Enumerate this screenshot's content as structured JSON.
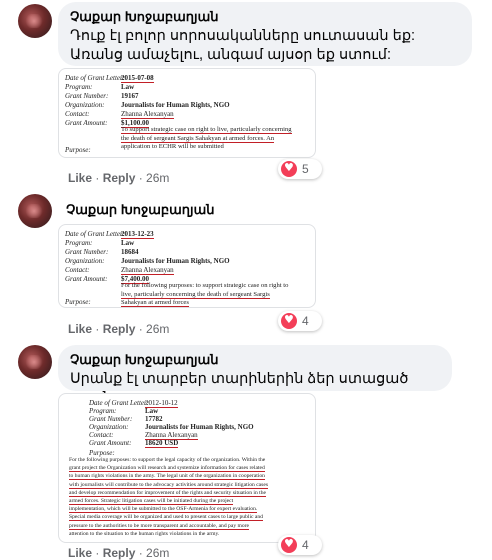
{
  "comments": [
    {
      "author": "Չաքար Խոջաբաղյան",
      "text": "Դուք էլ բոլոր սորոսականները սուտասան եք: Առանց ամաչելու, անգամ այսօր եք ստում:",
      "doc": {
        "rows": [
          {
            "label": "Date of Grant Letter:",
            "value": "2015-07-08"
          },
          {
            "label": "Program:",
            "value": "Law"
          },
          {
            "label": "Grant Number:",
            "value": "19167"
          },
          {
            "label": "Organization:",
            "value": "Journalists for Human Rights, NGO"
          },
          {
            "label": "Contact:",
            "value": "Zhanna Alexanyan"
          },
          {
            "label": "Grant Amount:",
            "value": "$1,100.00"
          },
          {
            "label": "Purpose:",
            "value": ""
          }
        ],
        "purpose_lines": [
          "To support strategic case on right to live, particularly concerning",
          "the death of sergeant Sargis Sahakyan at armed forces. An",
          "application to ECHR will be submitted"
        ]
      },
      "actions": {
        "like": "Like",
        "reply": "Reply",
        "time": "26m"
      },
      "reaction_count": "5"
    },
    {
      "author": "Չաքար Խոջաբաղյան",
      "doc": {
        "rows": [
          {
            "label": "Date of Grant Letter:",
            "value": "2013-12-23"
          },
          {
            "label": "Program:",
            "value": "Law"
          },
          {
            "label": "Grant Number:",
            "value": "18684"
          },
          {
            "label": "Organization:",
            "value": "Journalists for Human Rights, NGO"
          },
          {
            "label": "Contact:",
            "value": "Zhanna Alexanyan"
          },
          {
            "label": "Grant Amount:",
            "value": "$7,400.00"
          },
          {
            "label": "Purpose:",
            "value": ""
          }
        ],
        "purpose_lines": [
          "For the following purposes: to support strategic case on right to",
          "live, particularly concerning the death of sergeant Sargis",
          "Sahakyan at armed forces"
        ]
      },
      "actions": {
        "like": "Like",
        "reply": "Reply",
        "time": "26m"
      },
      "reaction_count": "4"
    },
    {
      "author": "Չաքար Խոջաբաղյան",
      "text": "Սրանք էլ տարբեր տարիներին ձեր ստացած գրանտը",
      "doc": {
        "rows": [
          {
            "label": "Date of Grant Letter:",
            "value": "2012-10-12"
          },
          {
            "label": "Program:",
            "value": "Law"
          },
          {
            "label": "Grant Number:",
            "value": "17782"
          },
          {
            "label": "Organization:",
            "value": "Journalists for Human Rights, NGO"
          },
          {
            "label": "Contact:",
            "value": "Zhanna Alexanyan"
          },
          {
            "label": "Grant Amount:",
            "value": "18620 USD"
          },
          {
            "label": "Purpose:",
            "value": ""
          }
        ],
        "purpose_lines": [
          "For the following purposes: to support the legal capacity of the organization. Within the",
          "grant project the Organization will research and systemize information for cases related",
          "to human rights violations in the army. The legal unit of the organization in cooperation",
          "with journalists will contribute to the advocacy activities around strategic litigation cases",
          "and develop recommendation for improvement of the rights and security situation in the",
          "armed forces. Strategic litigation cases will be initiated during the project",
          "implementation, which will be submitted to the OSF-Armenia for expert evaluation.",
          "Special media coverage will be organized and used to present cases to large public and",
          "pressure to the authorities to be more transparent and accountable, and pay more",
          "attention to the situation to the human rights violations in the army."
        ]
      },
      "actions": {
        "like": "Like",
        "reply": "Reply",
        "time": "26m"
      },
      "reaction_count": "4"
    }
  ],
  "colors": {
    "bubble": "#f0f2f5",
    "underline": "#c21f27",
    "heart": "#f33e58",
    "meta": "#65676b"
  }
}
